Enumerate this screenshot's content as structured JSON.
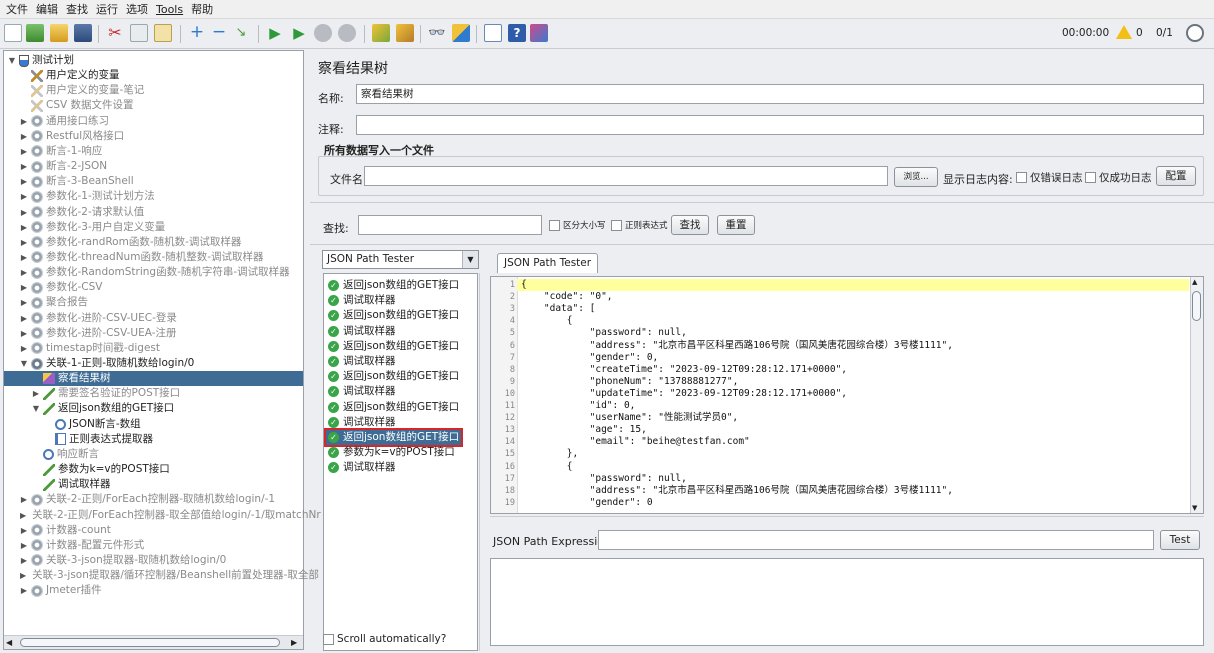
{
  "menu": [
    "文件",
    "编辑",
    "查找",
    "运行",
    "选项",
    "Tools",
    "帮助"
  ],
  "status": {
    "timer": "00:00:00",
    "warning_count": "0",
    "threads": "0/1"
  },
  "tree": [
    {
      "label": "测试计划",
      "icon": "flask-icon",
      "level": 0,
      "toggle": "▼"
    },
    {
      "label": "用户定义的变量",
      "icon": "tool-icon",
      "level": 1
    },
    {
      "label": "用户定义的变量-笔记",
      "icon": "tool-icon",
      "level": 1,
      "dim": true
    },
    {
      "label": "CSV 数据文件设置",
      "icon": "tool-icon",
      "level": 1,
      "dim": true
    },
    {
      "label": "通用接口练习",
      "icon": "gear-icon",
      "level": 1,
      "toggle": "▶",
      "dim": true
    },
    {
      "label": "Restful风格接口",
      "icon": "gear-icon",
      "level": 1,
      "toggle": "▶",
      "dim": true
    },
    {
      "label": "断言-1-响应",
      "icon": "gear-icon",
      "level": 1,
      "toggle": "▶",
      "dim": true
    },
    {
      "label": "断言-2-JSON",
      "icon": "gear-icon",
      "level": 1,
      "toggle": "▶",
      "dim": true
    },
    {
      "label": "断言-3-BeanShell",
      "icon": "gear-icon",
      "level": 1,
      "toggle": "▶",
      "dim": true
    },
    {
      "label": "参数化-1-测试计划方法",
      "icon": "gear-icon",
      "level": 1,
      "toggle": "▶",
      "dim": true
    },
    {
      "label": "参数化-2-请求默认值",
      "icon": "gear-icon",
      "level": 1,
      "toggle": "▶",
      "dim": true
    },
    {
      "label": "参数化-3-用户自定义变量",
      "icon": "gear-icon",
      "level": 1,
      "toggle": "▶",
      "dim": true
    },
    {
      "label": "参数化-randRom函数-随机数-调试取样器",
      "icon": "gear-icon",
      "level": 1,
      "toggle": "▶",
      "dim": true
    },
    {
      "label": "参数化-threadNum函数-随机整数-调试取样器",
      "icon": "gear-icon",
      "level": 1,
      "toggle": "▶",
      "dim": true
    },
    {
      "label": "参数化-RandomString函数-随机字符串-调试取样器",
      "icon": "gear-icon",
      "level": 1,
      "toggle": "▶",
      "dim": true
    },
    {
      "label": "参数化-CSV",
      "icon": "gear-icon",
      "level": 1,
      "toggle": "▶",
      "dim": true
    },
    {
      "label": "聚合报告",
      "icon": "gear-icon",
      "level": 1,
      "toggle": "▶",
      "dim": true
    },
    {
      "label": "参数化-进阶-CSV-UEC-登录",
      "icon": "gear-icon",
      "level": 1,
      "toggle": "▶",
      "dim": true
    },
    {
      "label": "参数化-进阶-CSV-UEA-注册",
      "icon": "gear-icon",
      "level": 1,
      "toggle": "▶",
      "dim": true
    },
    {
      "label": "timestap时间戳-digest",
      "icon": "gear-icon",
      "level": 1,
      "toggle": "▶",
      "dim": true
    },
    {
      "label": "关联-1-正则-取随机数给login/0",
      "icon": "gear-icon",
      "level": 1,
      "toggle": "▼"
    },
    {
      "label": "察看结果树",
      "icon": "chart-icon",
      "level": 2,
      "selected": true
    },
    {
      "label": "需要签名验证的POST接口",
      "icon": "pen-icon",
      "level": 2,
      "toggle": "▶",
      "dim": true
    },
    {
      "label": "返回json数组的GET接口",
      "icon": "pen-icon",
      "level": 2,
      "toggle": "▼"
    },
    {
      "label": "JSON断言-数组",
      "icon": "magnifier-icon",
      "level": 3
    },
    {
      "label": "正则表达式提取器",
      "icon": "extractor-icon",
      "level": 3
    },
    {
      "label": "响应断言",
      "icon": "magnifier-icon",
      "level": 2,
      "dim": true
    },
    {
      "label": "参数为k=v的POST接口",
      "icon": "pen-icon",
      "level": 2
    },
    {
      "label": "调试取样器",
      "icon": "pen-icon",
      "level": 2
    },
    {
      "label": "关联-2-正则/ForEach控制器-取随机数给login/-1",
      "icon": "gear-icon",
      "level": 1,
      "toggle": "▶",
      "dim": true
    },
    {
      "label": "关联-2-正则/ForEach控制器-取全部值给login/-1/取matchNr",
      "icon": "gear-icon",
      "level": 1,
      "toggle": "▶",
      "dim": true
    },
    {
      "label": "计数器-count",
      "icon": "gear-icon",
      "level": 1,
      "toggle": "▶",
      "dim": true
    },
    {
      "label": "计数器-配置元件形式",
      "icon": "gear-icon",
      "level": 1,
      "toggle": "▶",
      "dim": true
    },
    {
      "label": "关联-3-json提取器-取随机数给login/0",
      "icon": "gear-icon",
      "level": 1,
      "toggle": "▶",
      "dim": true
    },
    {
      "label": "关联-3-json提取器/循环控制器/Beanshell前置处理器-取全部",
      "icon": "gear-icon",
      "level": 1,
      "toggle": "▶",
      "dim": true
    },
    {
      "label": "Jmeter插件",
      "icon": "gear-icon",
      "level": 1,
      "toggle": "▶",
      "dim": true
    }
  ],
  "panel": {
    "title": "察看结果树",
    "name_label": "名称:",
    "name_value": "察看结果树",
    "comment_label": "注释:",
    "comment_value": "",
    "section_title": "所有数据写入一个文件",
    "file_label": "文件名",
    "file_value": "",
    "browse_button": "浏览...",
    "log_label": "显示日志内容:",
    "errors_only": "仅错误日志",
    "success_only": "仅成功日志",
    "configure_button": "配置",
    "search_label": "查找:",
    "search_value": "",
    "case_sensitive": "区分大小写",
    "regex": "正则表达式",
    "find_button": "查找",
    "reset_button": "重置",
    "renderer": "JSON Path Tester",
    "scroll_auto": "Scroll automatically?",
    "tab_label": "JSON Path Tester",
    "expr_label": "JSON Path Expression",
    "expr_value": "",
    "test_button": "Test"
  },
  "results": [
    {
      "label": "返回json数组的GET接口"
    },
    {
      "label": "调试取样器"
    },
    {
      "label": "返回json数组的GET接口"
    },
    {
      "label": "调试取样器"
    },
    {
      "label": "返回json数组的GET接口"
    },
    {
      "label": "调试取样器"
    },
    {
      "label": "返回json数组的GET接口"
    },
    {
      "label": "调试取样器"
    },
    {
      "label": "返回json数组的GET接口"
    },
    {
      "label": "调试取样器"
    },
    {
      "label": "返回json数组的GET接口",
      "selected": true
    },
    {
      "label": "参数为k=v的POST接口"
    },
    {
      "label": "调试取样器"
    }
  ],
  "json_lines": [
    "{",
    "    \"code\": \"0\",",
    "    \"data\": [",
    "        {",
    "            \"password\": null,",
    "            \"address\": \"北京市昌平区科星西路106号院（国风美唐花园综合楼）3号楼1111\",",
    "            \"gender\": 0,",
    "            \"createTime\": \"2023-09-12T09:28:12.171+0000\",",
    "            \"phoneNum\": \"13788881277\",",
    "            \"updateTime\": \"2023-09-12T09:28:12.171+0000\",",
    "            \"id\": 0,",
    "            \"userName\": \"性能测试学员0\",",
    "            \"age\": 15,",
    "            \"email\": \"beihe@testfan.com\"",
    "        },",
    "        {",
    "            \"password\": null,",
    "            \"address\": \"北京市昌平区科星西路106号院（国风美唐花园综合楼）3号楼1111\",",
    "            \"gender\": 0"
  ],
  "colors": {
    "selection": "#3e6c94",
    "highlight_border": "#d7262a",
    "line_highlight": "#ffff9e"
  }
}
